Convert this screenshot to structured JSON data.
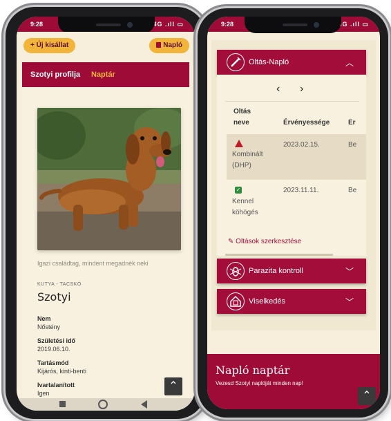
{
  "left_phone": {
    "status": {
      "time": "9:28",
      "icons": "4G .ıll ▭"
    },
    "new_puppy_label": "+ Új kisállat",
    "journal_label": "Napló",
    "tabs": {
      "profile": "Szotyi profilja",
      "calendar": "Naptár"
    },
    "dog_caption": "Igazi családtag, mindent megadnék neki",
    "breed_line": "KUTYA - TACSKÓ",
    "dog_name": "Szotyi",
    "fields": [
      {
        "label": "Nem",
        "value": "Nőstény"
      },
      {
        "label": "Születési idő",
        "value": "2019.06.10."
      },
      {
        "label": "Tartásmód",
        "value": "Kijárós, kinti-benti"
      },
      {
        "label": "Ivartalanított",
        "value": "Igen"
      }
    ]
  },
  "right_phone": {
    "status": {
      "time": "9:28",
      "icons": "4G .ıll ▭"
    },
    "vaccine_section": {
      "title": "Oltás-Napló",
      "nav_prev": "‹",
      "nav_next": "›",
      "col_name_1": "Oltás",
      "col_name_2": "neve",
      "col_validity": "Érvényessége",
      "col_extra": "Ér",
      "rows": [
        {
          "name_1": "Kombinált",
          "name_2": "(DHP)",
          "date": "2023.02.15.",
          "extra": "Be",
          "status": "warning"
        },
        {
          "name_1": "Kennel",
          "name_2": "köhögés",
          "date": "2023.11.11.",
          "extra": "Be",
          "status": "ok"
        }
      ],
      "edit_label": "Oltások szerkesztése"
    },
    "parasite_title": "Parazita kontroll",
    "behaviour_title": "Viselkedés",
    "calendar_banner": {
      "title": "Napló naptár",
      "subtitle": "Vezesd Szotyi naplóját minden nap!"
    }
  }
}
